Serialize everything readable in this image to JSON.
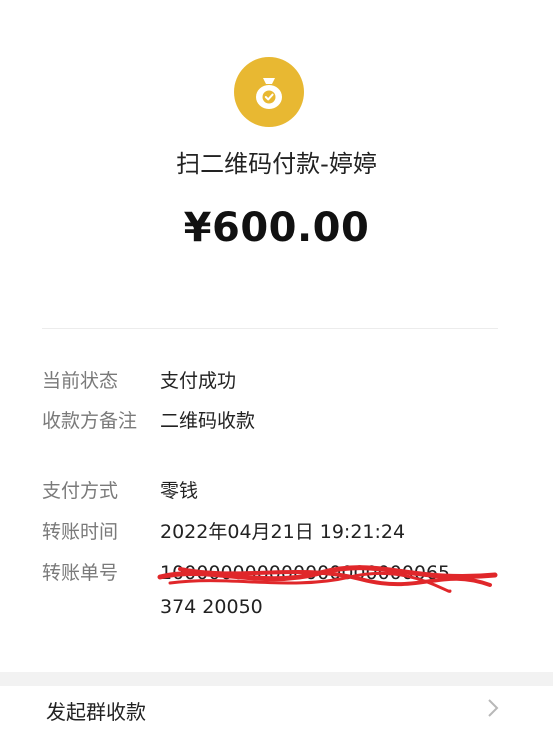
{
  "header": {
    "icon": "money-bag-check-icon",
    "title": "扫二维码付款-婷婷",
    "amount": "¥600.00"
  },
  "details": [
    {
      "label": "当前状态",
      "value": "支付成功"
    },
    {
      "label": "收款方备注",
      "value": "二维码收款"
    },
    {
      "label": "支付方式",
      "value": "零钱"
    },
    {
      "label": "转账时间",
      "value": "2022年04月21日 19:21:24"
    },
    {
      "label": "转账单号",
      "value": "100000000000000000000065374 20050"
    }
  ],
  "actions": {
    "group_collect": "发起群收款"
  },
  "colors": {
    "accent": "#e8b832",
    "redaction": "#e0272a"
  }
}
